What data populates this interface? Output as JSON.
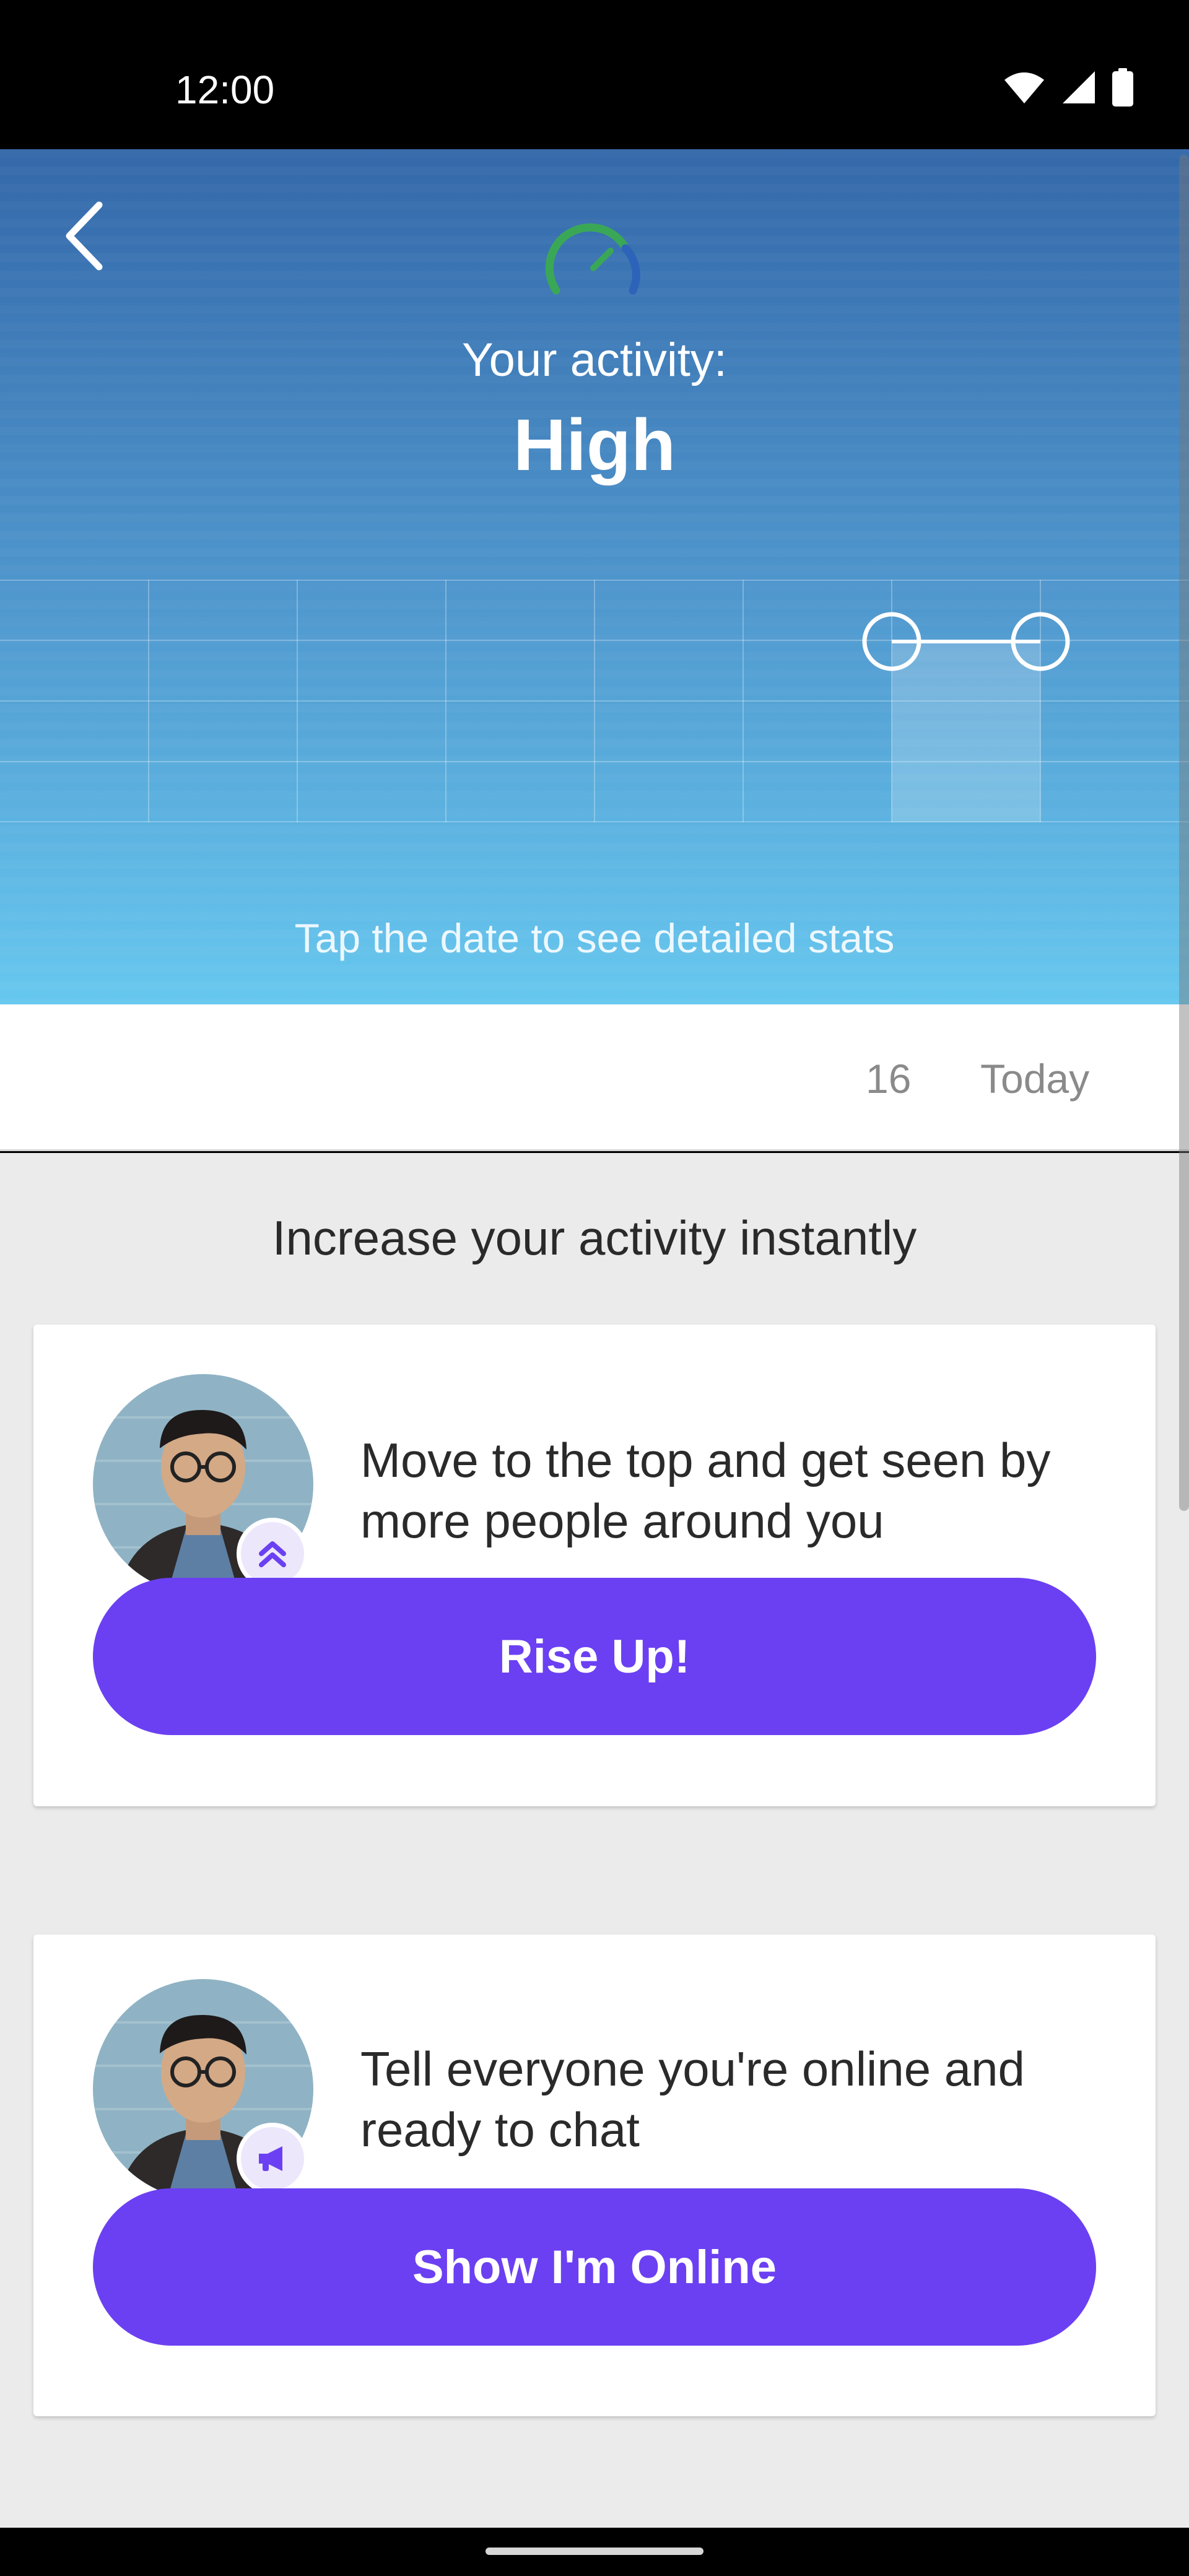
{
  "status_bar": {
    "time": "12:00",
    "icons": [
      "wifi-icon",
      "signal-icon",
      "battery-icon"
    ]
  },
  "header": {
    "back_icon": "chevron-left-icon",
    "gauge_icon": "speedometer-icon",
    "activity_label": "Your activity:",
    "activity_level": "High",
    "tap_hint": "Tap the date to see detailed stats"
  },
  "dates": [
    {
      "label": "16"
    },
    {
      "label": "Today"
    }
  ],
  "section_title": "Increase your activity instantly",
  "cards": [
    {
      "badge_icon": "double-chevron-up-icon",
      "text": "Move to the top and get seen by more people around you",
      "button_label": "Rise Up!"
    },
    {
      "badge_icon": "megaphone-icon",
      "text": "Tell everyone you're online and ready to chat",
      "button_label": "Show I'm Online"
    }
  ],
  "colors": {
    "accent": "#6b40f2",
    "header_top": "#3468a9",
    "header_bottom": "#67c8ef",
    "gauge_green": "#3aa757"
  }
}
